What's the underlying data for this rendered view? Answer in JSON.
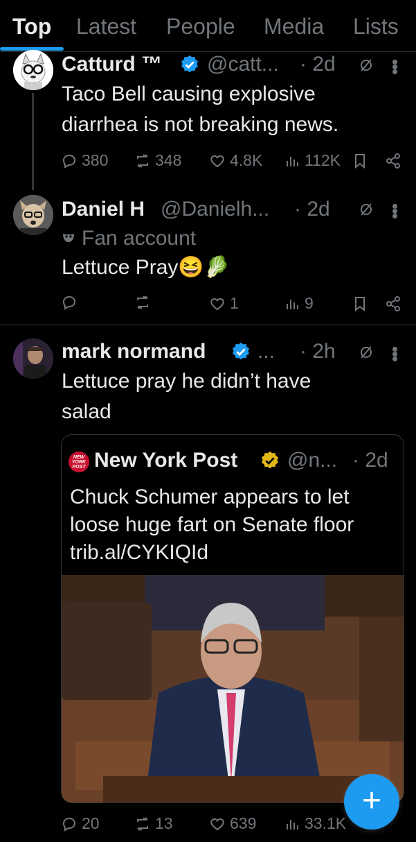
{
  "tabs": [
    {
      "label": "Top"
    },
    {
      "label": "Latest"
    },
    {
      "label": "People"
    },
    {
      "label": "Media"
    },
    {
      "label": "Lists"
    }
  ],
  "active_tab": "Top",
  "posts": [
    {
      "name": "Catturd ™",
      "handle": "@catt...",
      "time": "· 2d",
      "text": "Taco Bell causing explosive diarrhea is not breaking news.",
      "replies": "380",
      "reposts": "348",
      "likes": "4.8K",
      "views": "112K"
    },
    {
      "name": "Daniel H",
      "handle": "@Danielh...",
      "time": "· 2d",
      "label": "Fan account",
      "text": "Lettuce Pray😆🥬",
      "replies": "",
      "reposts": "",
      "likes": "1",
      "views": "9"
    },
    {
      "name": "mark normand",
      "handle": "...",
      "time": "· 2h",
      "text": "Lettuce pray he didn’t have salad",
      "quote": {
        "name": "New York Post",
        "logo_text": "NEW YORK POST",
        "handle": "@n...",
        "time": "· 2d",
        "text": "Chuck Schumer appears to let loose huge fart on Senate floor trib.al/CYKIQId"
      },
      "replies": "20",
      "reposts": "13",
      "likes": "639",
      "views": "33.1K"
    }
  ],
  "fab_label": "+",
  "colors": {
    "accent": "#1d9bf0",
    "muted": "#71767b",
    "gold": "#e2b719",
    "background": "#000000"
  }
}
